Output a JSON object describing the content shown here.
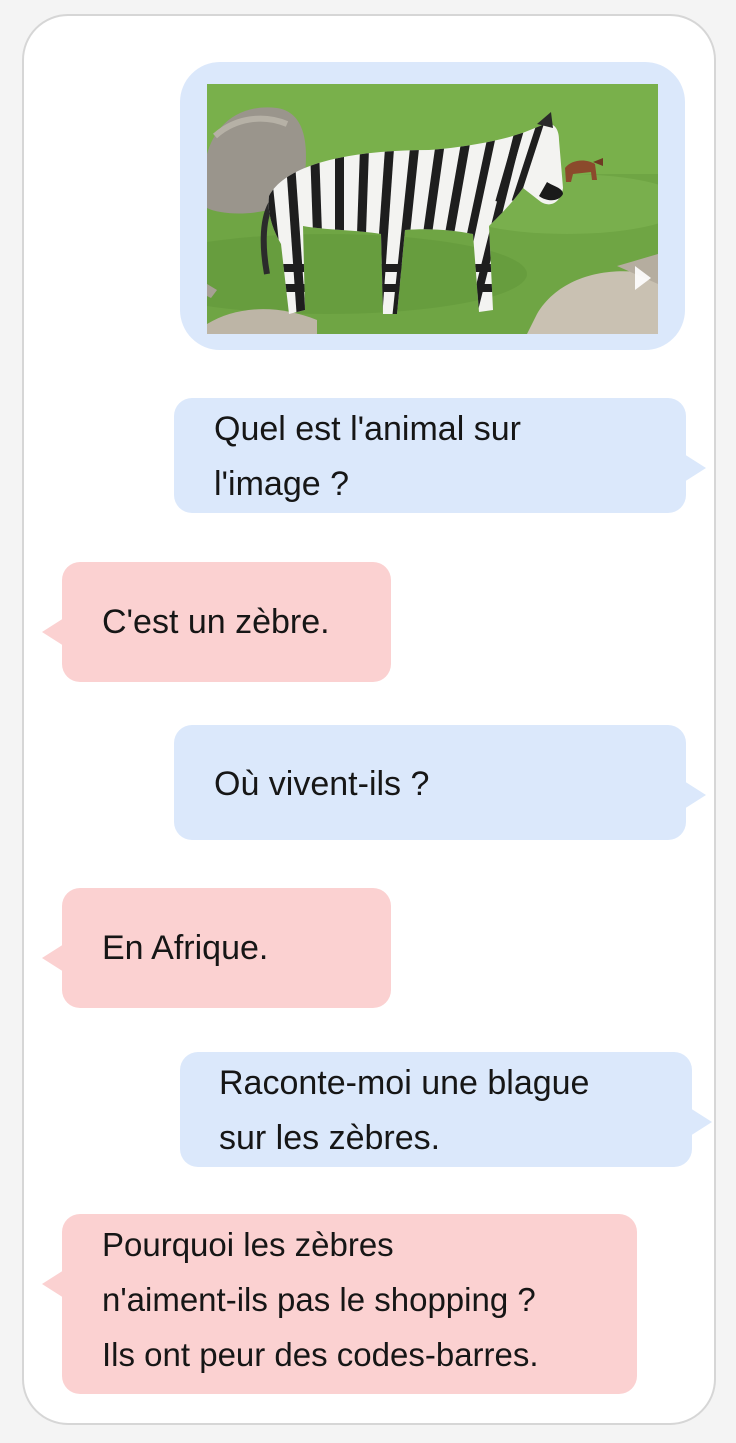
{
  "chat": {
    "image_message": {
      "photo_subject": "zebra standing on green grass with rocks",
      "play_icon": "play-icon"
    },
    "messages": [
      {
        "role": "user",
        "text": "Quel est l'animal sur\nl'image ?"
      },
      {
        "role": "assistant",
        "text": "C'est un zèbre."
      },
      {
        "role": "user",
        "text": "Où vivent-ils ?"
      },
      {
        "role": "assistant",
        "text": "En Afrique."
      },
      {
        "role": "user",
        "text": "Raconte-moi une blague\nsur les zèbres."
      },
      {
        "role": "assistant",
        "text": "Pourquoi les zèbres\nn'aiment-ils pas le shopping ?\nIls ont peur des codes-barres."
      }
    ]
  },
  "colors": {
    "user_bubble": "#dbe8fb",
    "assistant_bubble": "#fbd1d1",
    "frame_border": "#d6d6d6"
  }
}
